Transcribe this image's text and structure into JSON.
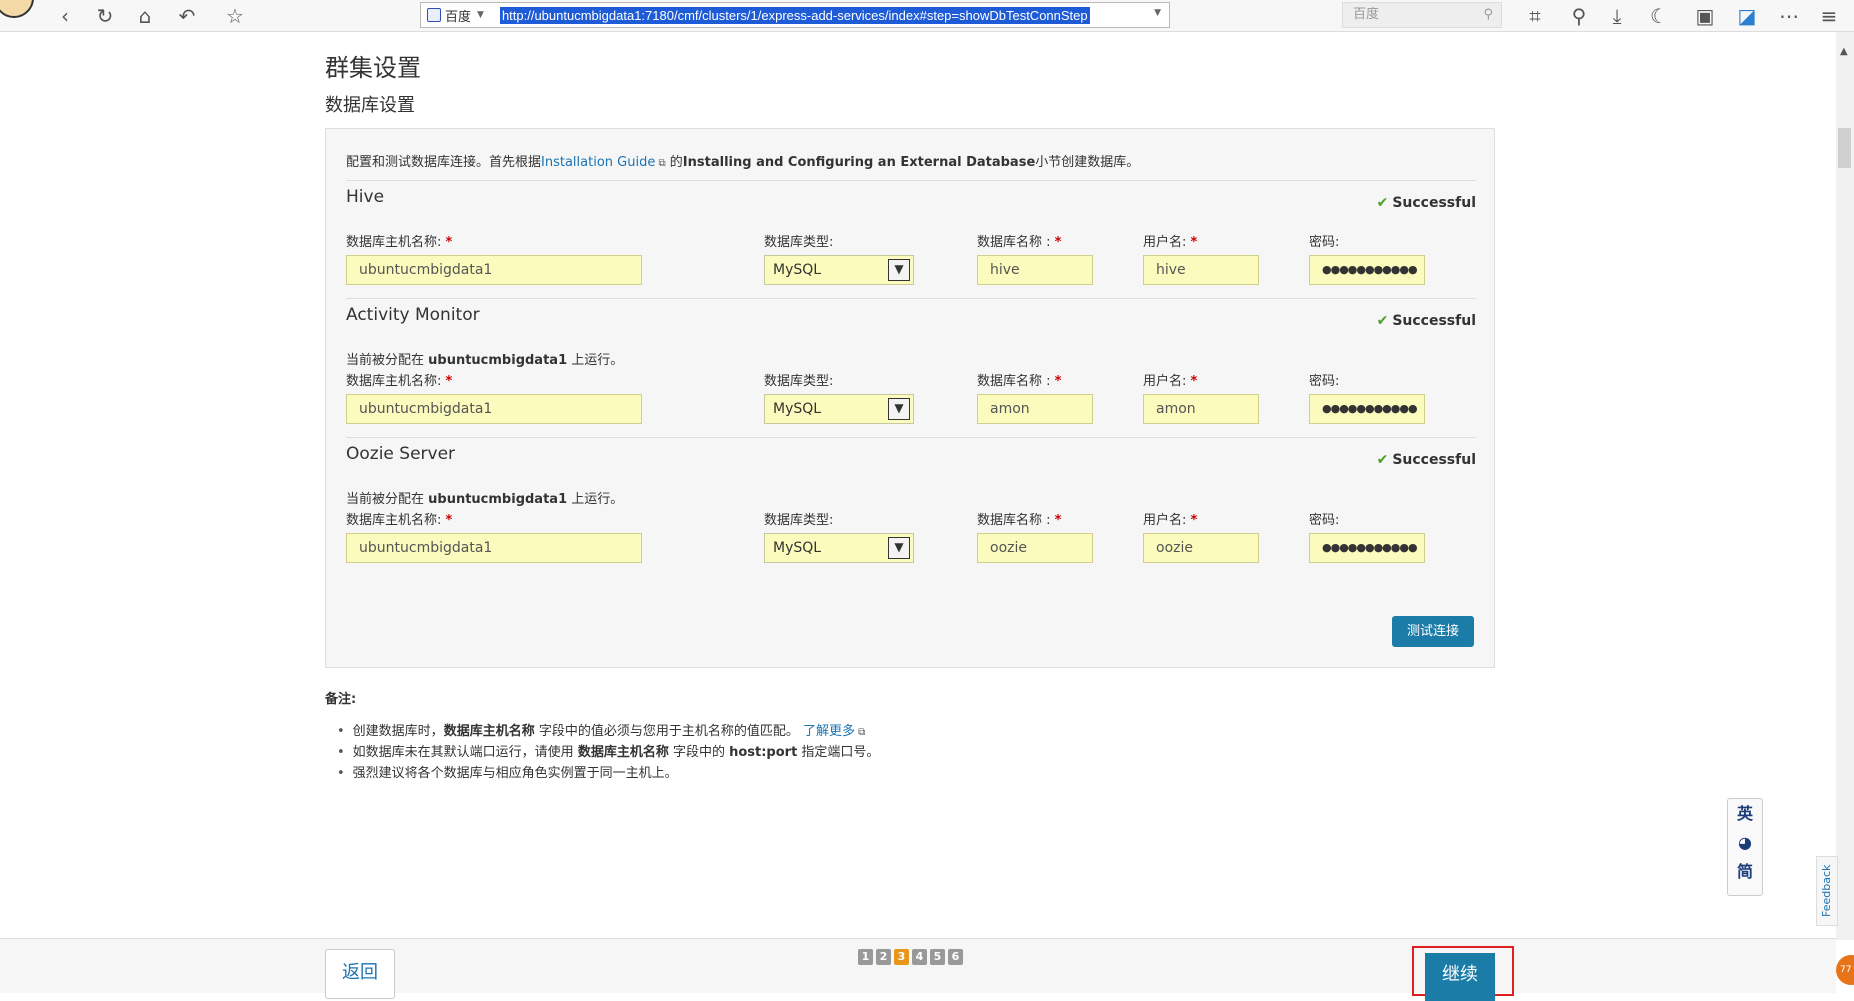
{
  "browser": {
    "engine_name": "百度",
    "url": "http://ubuntucmbigdata1:7180/cmf/clusters/1/express-add-services/index#step=showDbTestConnStep",
    "search_placeholder": "百度"
  },
  "page": {
    "title": "群集设置",
    "subtitle": "数据库设置",
    "intro": {
      "prefix": "配置和测试数据库连接。首先根据",
      "link": "Installation Guide",
      "middle": " 的",
      "bold": "Installing and Configuring an External Database",
      "suffix": "小节创建数据库。"
    },
    "labels": {
      "host": "数据库主机名称:",
      "type": "数据库类型:",
      "db_name": "数据库名称 :",
      "user": "用户名:",
      "password": "密码:",
      "required": "*",
      "assigned_prefix": "当前被分配在 ",
      "assigned_suffix": " 上运行。"
    },
    "sections": [
      {
        "title": "Hive",
        "status": "Successful",
        "assigned_host": "",
        "host": "ubuntucmbigdata1",
        "type": "MySQL",
        "db_name": "hive",
        "user": "hive",
        "password": "●●●●●●●●●●●"
      },
      {
        "title": "Activity Monitor",
        "status": "Successful",
        "assigned_host": "ubuntucmbigdata1",
        "host": "ubuntucmbigdata1",
        "type": "MySQL",
        "db_name": "amon",
        "user": "amon",
        "password": "●●●●●●●●●●●"
      },
      {
        "title": "Oozie Server",
        "status": "Successful",
        "assigned_host": "ubuntucmbigdata1",
        "host": "ubuntucmbigdata1",
        "type": "MySQL",
        "db_name": "oozie",
        "user": "oozie",
        "password": "●●●●●●●●●●●"
      }
    ],
    "test_button": "测试连接",
    "notes": {
      "title": "备注:",
      "items": [
        {
          "a": "创建数据库时，",
          "b": "数据库主机名称",
          "c": " 字段中的值必须与您用于主机名称的值匹配。 ",
          "link": "了解更多"
        },
        {
          "a": "如数据库未在其默认端口运行，请使用 ",
          "b": "数据库主机名称",
          "c": " 字段中的 ",
          "d": "host:port",
          "e": " 指定端口号。"
        },
        {
          "a": "强烈建议将各个数据库与相应角色实例置于同一主机上。"
        }
      ]
    }
  },
  "ime": {
    "top": "英",
    "mid": "◕",
    "bottom": "简"
  },
  "feedback": "Feedback",
  "footer": {
    "back": "返回",
    "steps": [
      "1",
      "2",
      "3",
      "4",
      "5",
      "6"
    ],
    "active_step": "3",
    "continue": "继续"
  },
  "corner_badge": "77",
  "colors": {
    "accent": "#1c7ca8",
    "success": "#4aa01f",
    "input_bg": "#fbfbbd",
    "active_step": "#e8961c",
    "highlight_box": "#e02020"
  }
}
